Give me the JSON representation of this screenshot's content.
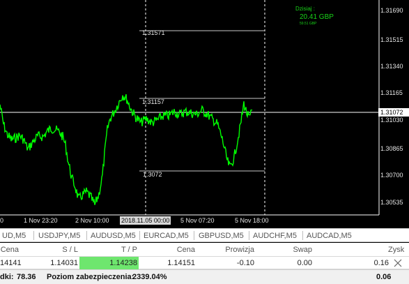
{
  "chart": {
    "y_axis_labels": [
      "1.31690",
      "1.31515",
      "1.31340",
      "1.31165",
      "1.31030",
      "1.30865",
      "1.30700",
      "1.30535"
    ],
    "current_price_label": "1.31072",
    "x_axis_labels": [
      "0",
      "1 Nov 23:20",
      "2 Nov 10:00",
      "5 Nov 07:20",
      "5 Nov 18:00"
    ],
    "cursor_time_label": "2018.11.05 00:00",
    "level_labels": [
      "1.31571",
      "1.31157",
      "1.3072"
    ],
    "profit": {
      "title": "Dzisiaj :",
      "value": "20.41 GBP",
      "subtitle": "59.51 GBP"
    },
    "colors": {
      "background": "#000000",
      "price_line": "#00ff00",
      "grid_line": "#ffffff",
      "text": "#e6e6e6",
      "accent": "#18d418"
    }
  },
  "tabs": [
    "UD,M5",
    "USDJPY,M5",
    "AUDUSD,M5",
    "EURCAD,M5",
    "GBPUSD,M5",
    "AUDCHF,M5",
    "AUDCAD,M5"
  ],
  "table": {
    "headers": [
      "Cena",
      "S / L",
      "T / P",
      "Cena",
      "Prowizja",
      "Swap",
      "Zysk"
    ],
    "rows": [
      {
        "price_open": "14141",
        "sl": "1.14031",
        "tp": "1.14238",
        "price_current": "1.14151",
        "commission": "-0.10",
        "swap": "0.00",
        "profit": "0.16"
      }
    ]
  },
  "status_bar": {
    "balance_label": "dki:",
    "balance_value": "78.36",
    "margin_level_label": "Poziom zabezpieczenia:",
    "margin_level_value": "2339.04%",
    "total_profit": "0.06"
  }
}
